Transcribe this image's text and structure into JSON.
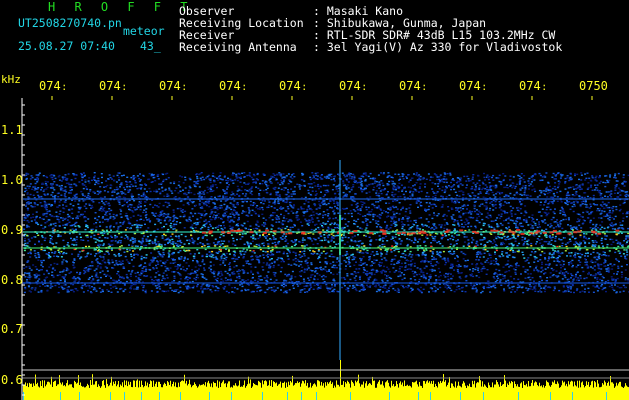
{
  "header": {
    "title": "H R O F F T",
    "filename": "UT2508270740.pn",
    "mode": "meteor",
    "datetime": "25.08.27 07:40",
    "count": "43_",
    "labels": {
      "observer": "Observer",
      "location": "Receiving Location",
      "receiver": "Receiver",
      "antenna": "Receiving Antenna"
    },
    "values": {
      "observer": ": Masaki Kano",
      "location": ": Shibukawa, Gunma, Japan",
      "receiver": ": RTL-SDR SDR# 43dB L15 103.2MHz CW",
      "antenna": ": 3el Yagi(V) Az 330 for Vladivostok"
    }
  },
  "axis": {
    "unit": "kHz",
    "time_ticks": [
      "074։",
      "074։",
      "074։",
      "074։",
      "074։",
      "074։",
      "074։",
      "074։",
      "074։",
      "0750"
    ],
    "freq_ticks": [
      "1.1",
      "1.0",
      "0.9",
      "0.8",
      "0.7",
      "0.6"
    ]
  },
  "colors": {
    "title": "#22dd22",
    "text": "#22d6e6",
    "axis": "#ffff22",
    "waterfall_low": "#0a1a8a",
    "waterfall_high": "#ff3322",
    "signal_bar": "#ffff00"
  }
}
